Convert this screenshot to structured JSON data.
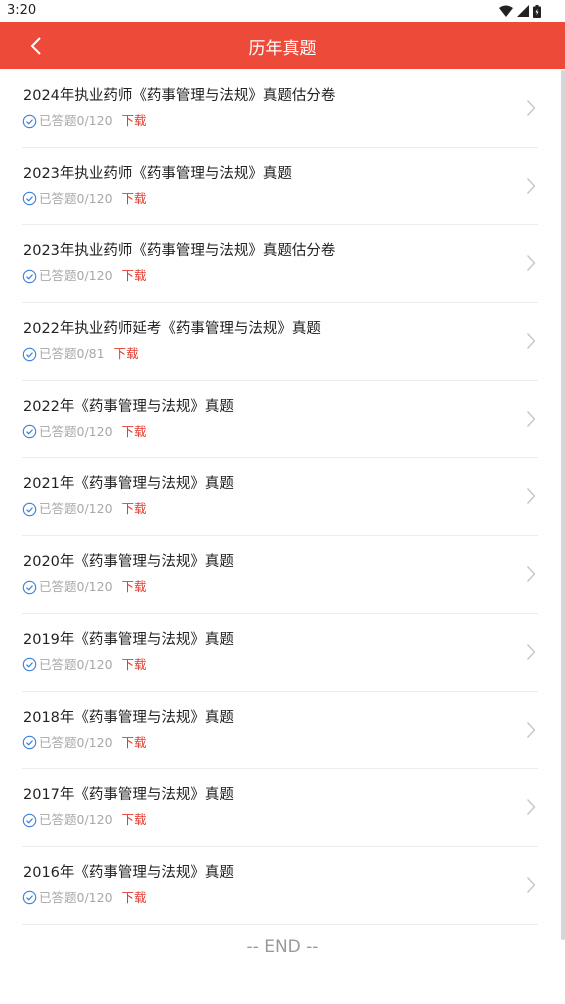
{
  "status_bar": {
    "time": "3:20"
  },
  "header": {
    "title": "历年真题"
  },
  "items": [
    {
      "title": "2024年执业药师《药事管理与法规》真题估分卷",
      "progress": "已答题0/120",
      "download": "下载"
    },
    {
      "title": "2023年执业药师《药事管理与法规》真题",
      "progress": "已答题0/120",
      "download": "下载"
    },
    {
      "title": "2023年执业药师《药事管理与法规》真题估分卷",
      "progress": "已答题0/120",
      "download": "下载"
    },
    {
      "title": "2022年执业药师延考《药事管理与法规》真题",
      "progress": "已答题0/81",
      "download": "下载"
    },
    {
      "title": "2022年《药事管理与法规》真题",
      "progress": "已答题0/120",
      "download": "下载"
    },
    {
      "title": "2021年《药事管理与法规》真题",
      "progress": "已答题0/120",
      "download": "下载"
    },
    {
      "title": "2020年《药事管理与法规》真题",
      "progress": "已答题0/120",
      "download": "下载"
    },
    {
      "title": "2019年《药事管理与法规》真题",
      "progress": "已答题0/120",
      "download": "下载"
    },
    {
      "title": "2018年《药事管理与法规》真题",
      "progress": "已答题0/120",
      "download": "下载"
    },
    {
      "title": "2017年《药事管理与法规》真题",
      "progress": "已答题0/120",
      "download": "下载"
    },
    {
      "title": "2016年《药事管理与法规》真题",
      "progress": "已答题0/120",
      "download": "下载"
    }
  ],
  "footer": {
    "end_text": "-- END --"
  },
  "colors": {
    "accent": "#ee4a3a",
    "download": "#e23b2f",
    "check": "#3b7fd8"
  }
}
